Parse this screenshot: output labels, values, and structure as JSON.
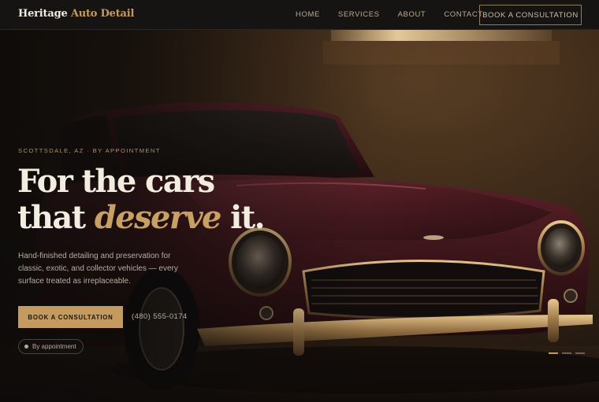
{
  "header": {
    "brand_part1": "Heritage",
    "brand_part2": "Auto Detail",
    "nav": [
      "HOME",
      "SERVICES",
      "ABOUT",
      "CONTACT"
    ],
    "cta_label": "BOOK A CONSULTATION"
  },
  "hero": {
    "eyebrow": "SCOTTSDALE, AZ · BY APPOINTMENT",
    "headline_line1": "For the cars",
    "headline_line2_pre": "that ",
    "headline_line2_accent": "deserve",
    "headline_line2_post": " it.",
    "lede": "Hand-finished detailing and preservation for classic, exotic, and collector vehicles — every surface treated as irreplaceable.",
    "primary_button": "BOOK A CONSULTATION",
    "phone": "(480) 555-0174",
    "badge": "By appointment",
    "slides_total": 3,
    "slides_active": 1,
    "image": "classic-car-photo"
  },
  "colors": {
    "accent": "#c49a5e",
    "header_bg": "#161412",
    "headline": "#f3ece1",
    "car_body": "#3a1418"
  }
}
